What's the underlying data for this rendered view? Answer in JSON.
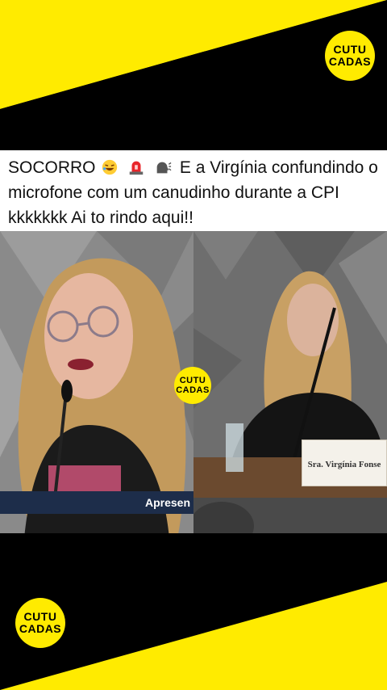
{
  "brand": {
    "logo_top_line": "CUTU",
    "logo_bottom_line": "CADAS",
    "accent_yellow": "#ffeb00"
  },
  "caption": {
    "text_line1_prefix": "SOCORRO",
    "emojis": [
      "rolling-on-floor-laughing-emoji",
      "police-light-emoji",
      "speaking-head-emoji"
    ],
    "text_line1_suffix": "E a Virgínia confundindo o",
    "text_line2": "microfone com um canudinho durante a CPI",
    "text_line3": "kkkkkkk Ai to rindo aqui!!"
  },
  "video": {
    "lower_third_text": "Apresen",
    "nameplate_text": "Sra. Virgínia Fonse"
  }
}
